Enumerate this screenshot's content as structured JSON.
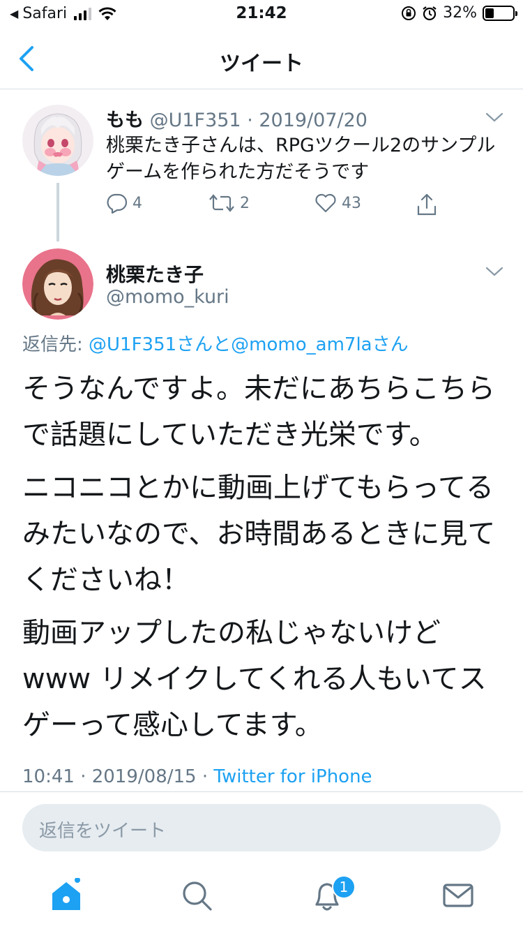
{
  "status_bar": {
    "back_app": "Safari",
    "time": "21:42",
    "battery_percent": "32%",
    "battery_level": 0.32
  },
  "nav": {
    "title": "ツイート",
    "back_icon": "chevron-left-icon"
  },
  "parent_tweet": {
    "display_name": "もも",
    "handle": "@U1F351",
    "date": "· 2019/07/20",
    "text": "桃栗たき子さんは、RPGツクール2のサンプルゲームを作られた方だそうです",
    "replies": "4",
    "retweets": "2",
    "likes": "43"
  },
  "main_tweet": {
    "display_name": "桃栗たき子",
    "handle": "@momo_kuri",
    "reply_label": "返信先:",
    "reply_targets": "@U1F351さんと@momo_am7laさん",
    "paragraphs": [
      "そうなんですよ。未だにあちらこちらで話題にしていただき光栄です。",
      "ニコニコとかに動画上げてもらってるみたいなので、お時間あるときに見てくださいね！",
      "動画アップしたの私じゃないけどwww リメイクしてくれる人もいてスゲーって感心してます。"
    ],
    "time": "10:41 · 2019/08/15 ·",
    "source": "Twitter for iPhone"
  },
  "reply_box": {
    "placeholder": "返信をツイート"
  },
  "tab_bar": {
    "items": [
      "home-icon",
      "search-icon",
      "notifications-icon",
      "messages-icon"
    ],
    "notification_count": "1"
  },
  "colors": {
    "accent": "#1da1f2",
    "secondary_text": "#657786",
    "divider": "#d8dee3"
  }
}
